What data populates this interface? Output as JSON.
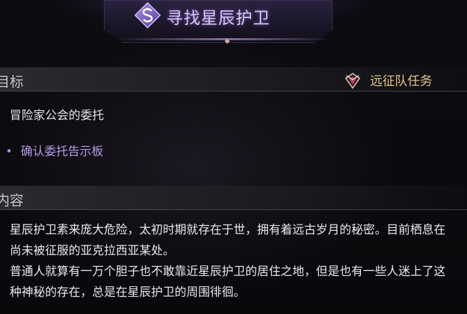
{
  "quest": {
    "title": "寻找星辰护卫",
    "icon": "quest-swirl-icon",
    "accent_color": "#b79ce8"
  },
  "target_section": {
    "label": "目标",
    "faction_label": "远征队任务",
    "faction_icon": "expedition-emblem-icon",
    "entrust_text": "冒险家公会的委托",
    "objective": "确认委托告示板"
  },
  "content_section": {
    "label": "内容",
    "paragraph_1": "星辰护卫素来庞大危险，太初时期就存在于世，拥有着远古岁月的秘密。目前栖息在尚未被征服的亚克拉西亚某处。",
    "paragraph_2": "普通人就算有一万个胆子也不敢靠近星辰护卫的居住之地，但是也有一些人迷上了这种神秘的存在，总是在星辰护卫的周围徘徊。"
  }
}
